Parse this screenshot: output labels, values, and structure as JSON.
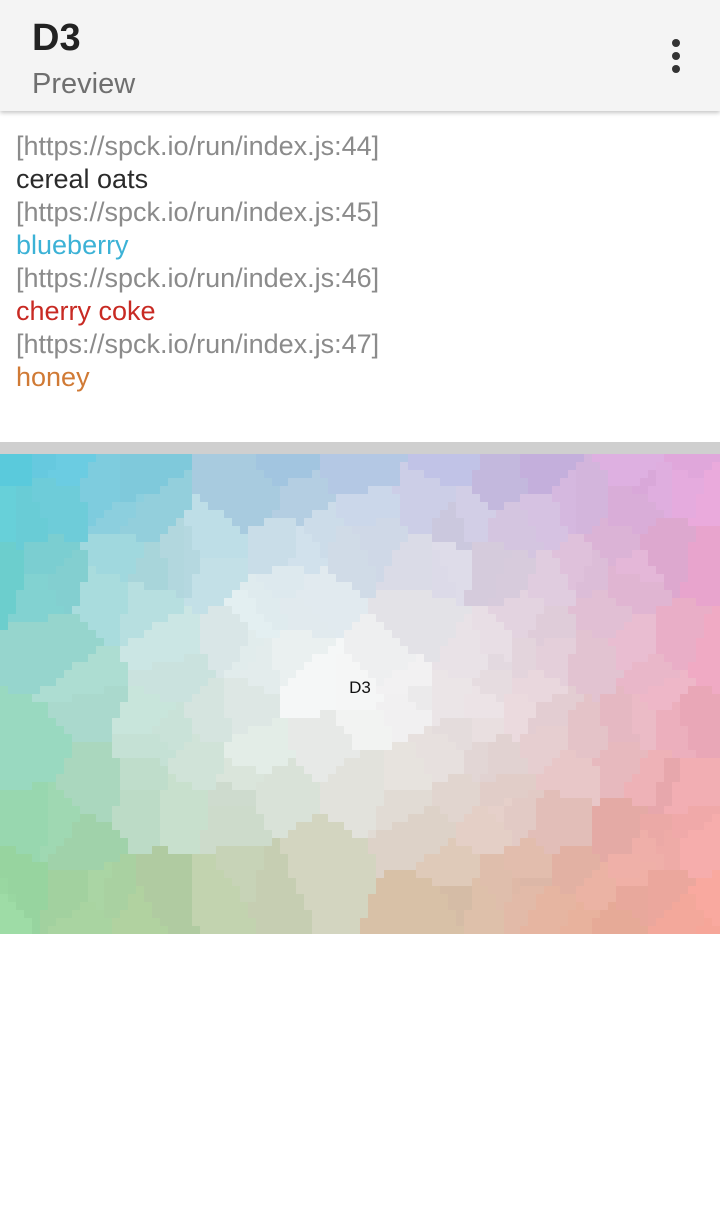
{
  "appbar": {
    "title": "D3",
    "subtitle": "Preview",
    "menu_icon": "more-vert-icon"
  },
  "console": {
    "entries": [
      {
        "source": "[https://spck.io/run/index.js:44]",
        "message": "cereal oats",
        "color": "#2b2b2b"
      },
      {
        "source": "[https://spck.io/run/index.js:45]",
        "message": "blueberry",
        "color": "#3cb2d6"
      },
      {
        "source": "[https://spck.io/run/index.js:46]",
        "message": "cherry coke",
        "color": "#c82a23"
      },
      {
        "source": "[https://spck.io/run/index.js:47]",
        "message": "honey",
        "color": "#d07a35"
      }
    ]
  },
  "canvas": {
    "label": "D3",
    "corner_colors": {
      "top_left": "#5ccde0",
      "top_right": "#e8a8e0",
      "bottom_left": "#9fd99c",
      "bottom_right": "#f9a79a",
      "center": "#ffffff"
    }
  }
}
